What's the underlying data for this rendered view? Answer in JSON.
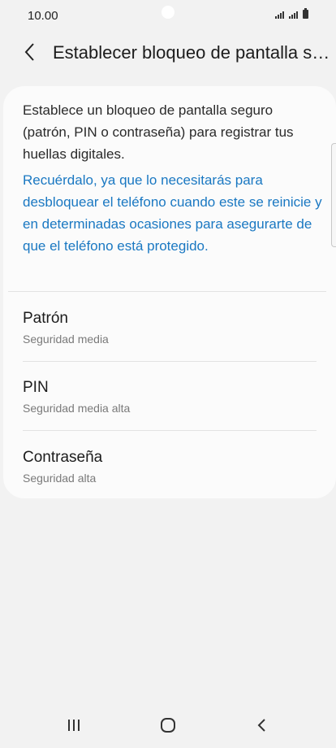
{
  "status_bar": {
    "time": "10.00",
    "icons": [
      "signal-icon",
      "signal-icon",
      "battery-icon"
    ]
  },
  "header": {
    "back_icon": "chevron-left-icon",
    "title": "Establecer bloqueo de pantalla se..."
  },
  "main": {
    "description": "Establece un bloqueo de pantalla seguro (patrón, PIN o contraseña) para registrar tus huellas digitales.",
    "note": "Recuérdalo, ya que lo necesitarás para desbloquear el teléfono cuando este se reinicie y en determinadas ocasiones para asegurarte de que el teléfono está protegido.",
    "note_color": "#1a78c2",
    "options": [
      {
        "label": "Patrón",
        "sublabel": "Seguridad media"
      },
      {
        "label": "PIN",
        "sublabel": "Seguridad media alta"
      },
      {
        "label": "Contraseña",
        "sublabel": "Seguridad alta"
      }
    ]
  },
  "nav_bar": {
    "buttons": [
      "recent-apps-icon",
      "home-icon",
      "back-icon"
    ]
  }
}
